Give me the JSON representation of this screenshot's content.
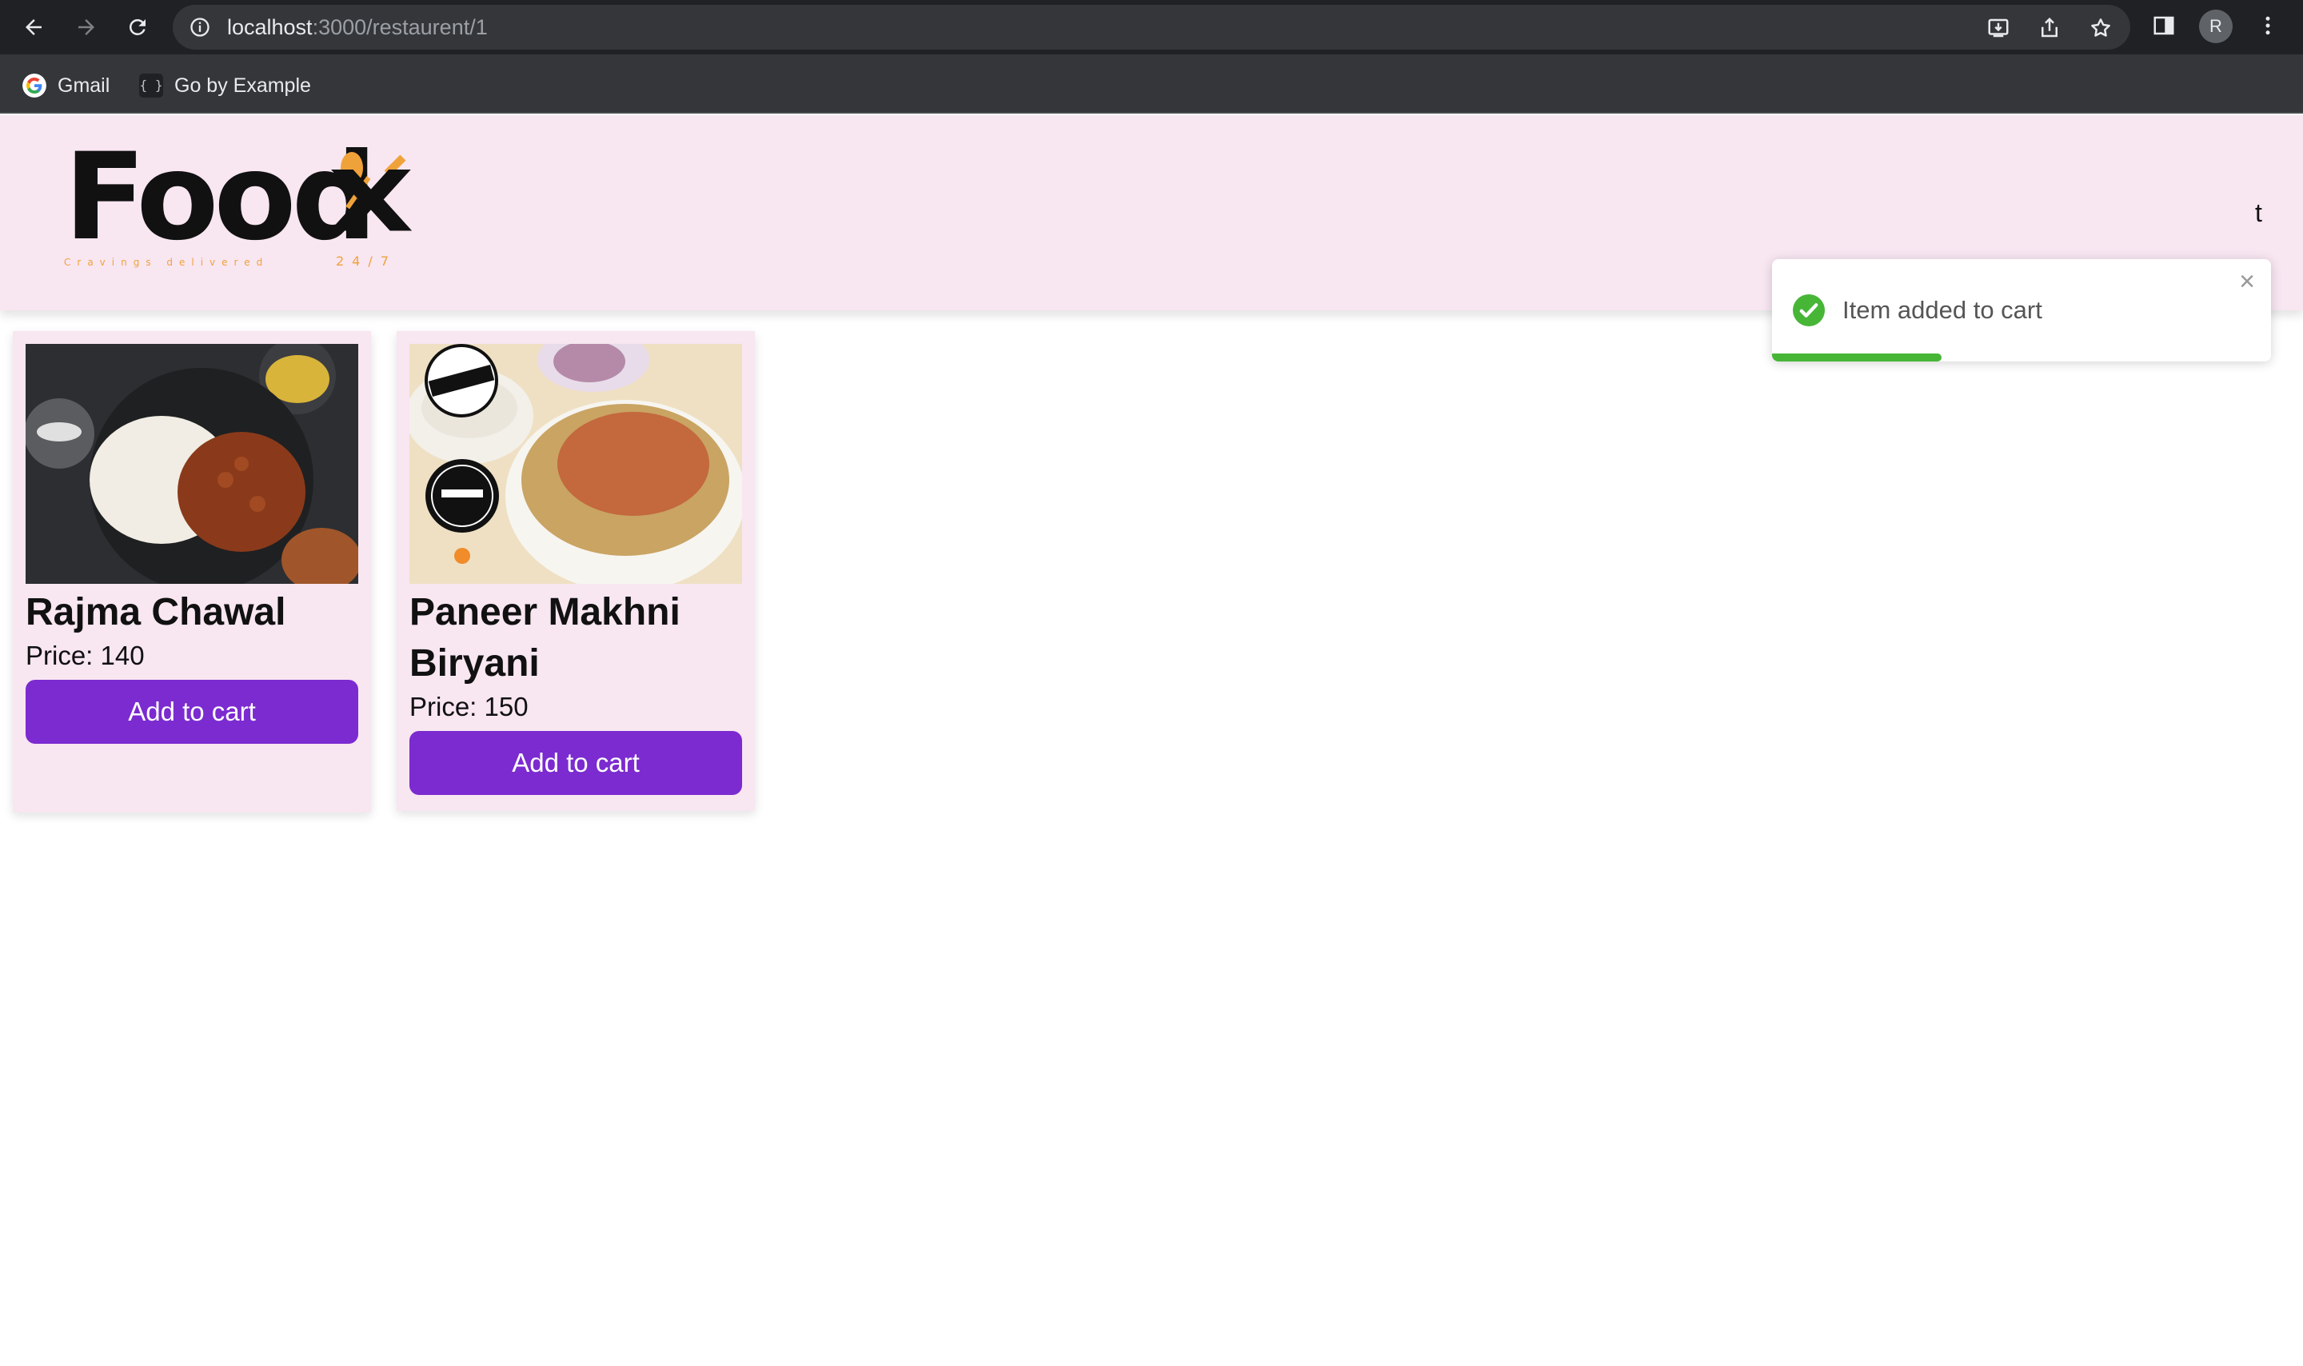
{
  "browser": {
    "url_host": "localhost",
    "url_path": ":3000/restaurent/1",
    "profile_initial": "R",
    "bookmarks": [
      {
        "label": "Gmail",
        "icon": "google-icon"
      },
      {
        "label": "Go by Example",
        "icon": "code-braces-icon"
      }
    ]
  },
  "header": {
    "logo_text": "Food",
    "logo_mark": "X",
    "logo_tagline": "Cravings delivered",
    "logo_hours": "24/7",
    "right_link_partial": "t"
  },
  "toast": {
    "message": "Item added to cart",
    "close_glyph": "×",
    "progress_fraction": 0.34,
    "accent_color": "#47b637"
  },
  "menu": {
    "items": [
      {
        "name": "Rajma Chawal",
        "price_text": "Price: 140",
        "button_label": "Add to cart"
      },
      {
        "name": "Paneer Makhni Biryani",
        "price_text": "Price: 150",
        "button_label": "Add to cart"
      }
    ]
  },
  "colors": {
    "header_bg": "#f8e6f1",
    "button_bg": "#7b2bd0",
    "card_bg": "#f8e6f1"
  }
}
